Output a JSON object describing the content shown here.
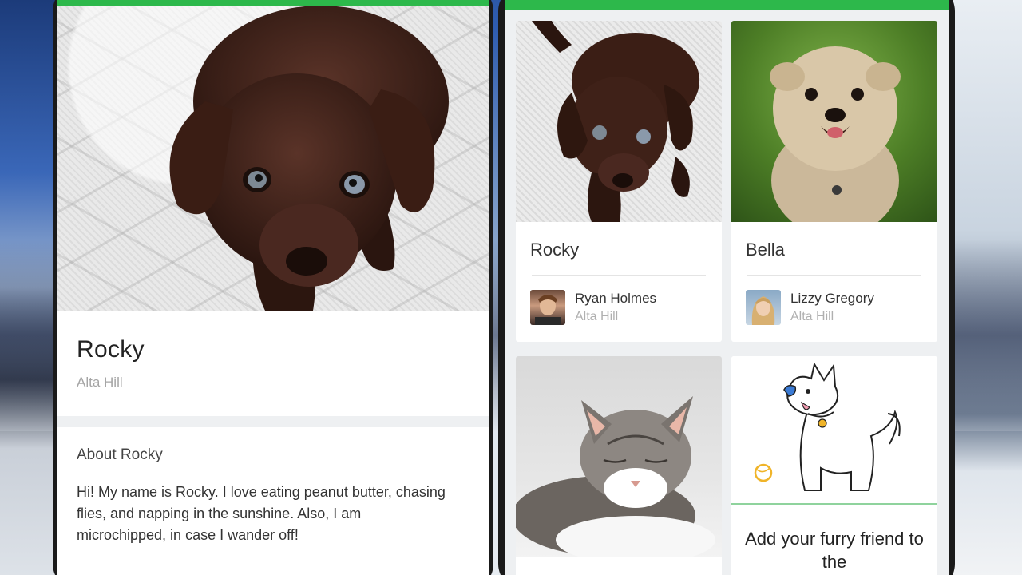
{
  "detail": {
    "pet_name": "Rocky",
    "location": "Alta Hill",
    "about_title": "About Rocky",
    "about_text": "Hi! My name is Rocky. I love eating peanut butter, chasing flies, and napping in the sunshine. Also, I am microchipped, in case I wander off!"
  },
  "grid": {
    "cards": [
      {
        "pet_name": "Rocky",
        "owner_name": "Ryan Holmes",
        "owner_location": "Alta Hill",
        "photo": "brown-puppy"
      },
      {
        "pet_name": "Bella",
        "owner_name": "Lizzy Gregory",
        "owner_location": "Alta Hill",
        "photo": "yorkie-dog"
      },
      {
        "photo": "tabby-cat"
      }
    ],
    "add_card": {
      "text": "Add your furry friend to the"
    }
  },
  "colors": {
    "accent": "#2db84b",
    "muted_text": "#a5a5a5"
  }
}
